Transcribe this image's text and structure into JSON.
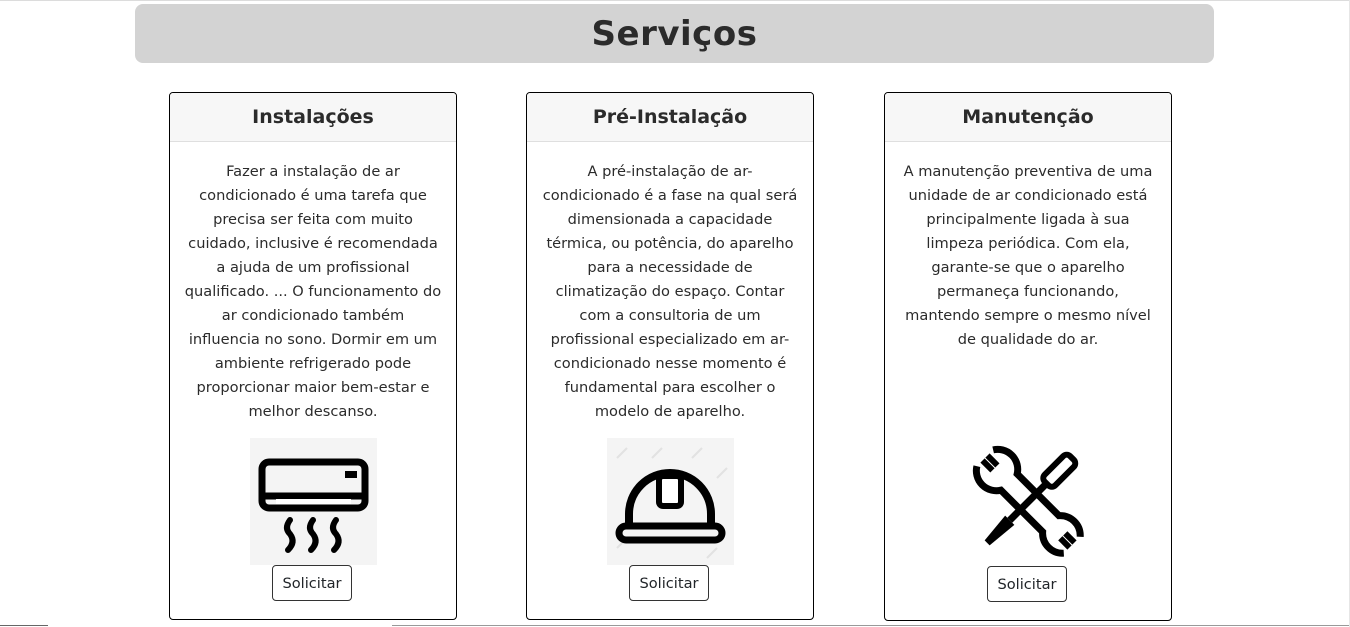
{
  "header": {
    "title": "Serviços"
  },
  "cards": [
    {
      "title": "Instalações",
      "text": "Fazer a instalação de ar condicionado é uma tarefa que precisa ser feita com muito cuidado, inclusive é recomendada a ajuda de um profissional qualificado. ... O funcionamento do ar condicionado também influencia no sono. Dormir em um ambiente refrigerado pode proporcionar maior bem-estar e melhor descanso.",
      "icon": "air-conditioner-icon",
      "button_label": "Solicitar"
    },
    {
      "title": "Pré-Instalação",
      "text": "A pré-instalação de ar-condicionado é a fase na qual será dimensionada a capacidade térmica, ou potência, do aparelho para a necessidade de climatização do espaço. Contar com a consultoria de um profissional especializado em ar-condicionado nesse momento é fundamental para escolher o modelo de aparelho.",
      "icon": "hard-hat-icon",
      "button_label": "Solicitar"
    },
    {
      "title": "Manutenção",
      "text": "A manutenção preventiva de uma unidade de ar condicionado está principalmente ligada à sua limpeza periódica. Com ela, garante-se que o aparelho permaneça funcionando, mantendo sempre o mesmo nível de qualidade do ar.",
      "icon": "wrench-screwdriver-icon",
      "button_label": "Solicitar"
    }
  ]
}
